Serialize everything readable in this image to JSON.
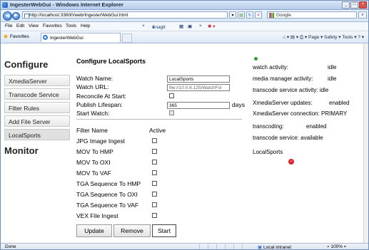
{
  "window": {
    "title": "IngesterWebGui - Windows Internet Explorer"
  },
  "address_bar": {
    "url": "http://localhost:33600/web/IngesterWebGui.html",
    "search_text": "Google"
  },
  "menu": [
    "File",
    "Edit",
    "View",
    "Favorites",
    "Tools",
    "Help"
  ],
  "menu_tools": {
    "close_x": "×",
    "snagit": "SnagIt"
  },
  "favorites": {
    "label": "Favorites",
    "tab_title": "IngesterWebGui"
  },
  "command_bar": "Page ▾  Safety ▾  Tools ▾",
  "sidebar": {
    "configure_heading": "Configure",
    "items": [
      "XmediaServer",
      "Transcode Service",
      "Filter Rules",
      "Add File Server",
      "LocalSports"
    ],
    "monitor_heading": "Monitor"
  },
  "config": {
    "title": "Configure LocalSports",
    "watch_name_label": "Watch Name:",
    "watch_name_value": "LocalSports",
    "watch_url_label": "Watch URL:",
    "watch_url_value": "file://10.0.6.125/WatchFol",
    "reconcile_label": "Reconcile At Start:",
    "publish_label": "Publish Lifespan:",
    "publish_value": "365",
    "publish_unit": "days",
    "start_watch_label": "Start Watch:",
    "filter_col_name": "Filter Name",
    "filter_col_active": "Active",
    "filters": [
      "JPG Image Ingest",
      "MOV To HMP",
      "MOV To OXI",
      "MOV To VAF",
      "TGA Sequence To HMP",
      "TGA Sequence To OXI",
      "TGA Sequence To VAF",
      "VEX File Ingest"
    ],
    "buttons": {
      "update": "Update",
      "remove": "Remove",
      "start": "Start"
    }
  },
  "status": {
    "watch_activity_label": "watch activity:",
    "watch_activity_value": "idle",
    "media_manager_label": "media manager activity:",
    "media_manager_value": "idle",
    "transcode_activity": "transcode service activity: idle",
    "xmedia_updates_label": "XmediaServer updates:",
    "xmedia_updates_value": "enabled",
    "xmedia_connection": "XmediaServer connection: PRIMARY",
    "transcoding_label": "transcoding:",
    "transcoding_value": "enabled",
    "transcode_service": "transcode service: available",
    "local_sports": "LocalSports"
  },
  "status_bar": {
    "left": "Done",
    "zone": "Local intranet",
    "zoom": "100%"
  },
  "colors": {
    "status_ok": "#2ca02c",
    "status_stop": "#d9262a"
  }
}
